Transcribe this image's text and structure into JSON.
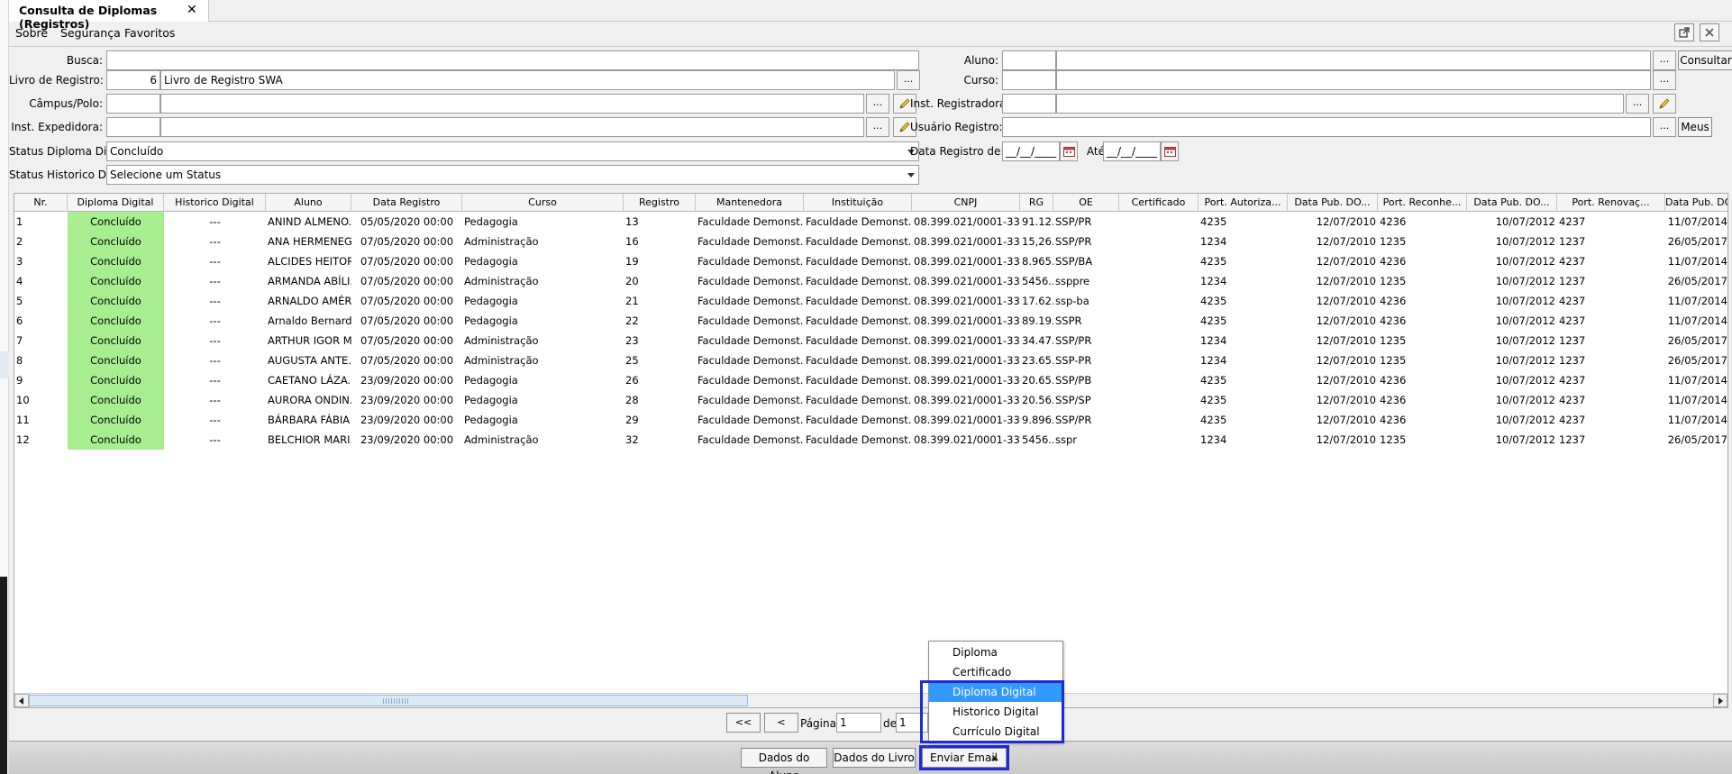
{
  "window": {
    "tab_title": "Consulta de Diplomas (Registros)",
    "tab_close": "✕"
  },
  "menu": {
    "sobre": "Sobre",
    "seguranca": "Segurança",
    "favoritos": "Favoritos"
  },
  "form": {
    "busca_label": "Busca:",
    "livro_label": "Livro de Registro:",
    "livro_code": "6",
    "livro_name": "Livro de Registro SWA",
    "campus_label": "Câmpus/Polo:",
    "inst_expedidora_label": "Inst. Expedidora:",
    "status_diploma_label": "Status Diploma Digital:",
    "status_diploma_value": "Concluído",
    "status_historico_label": "Status Historico Digital:",
    "status_historico_value": "Selecione um Status",
    "aluno_label": "Aluno:",
    "curso_label": "Curso:",
    "inst_registradora_label": "Inst. Registradora:",
    "usuario_registro_label": "Usuário Registro:",
    "data_registro_label": "Data Registro de:",
    "ate_label": "Até:",
    "date_mask": "__/__/____",
    "dots": "...",
    "consultar": "Consultar",
    "meus": "Meus"
  },
  "table": {
    "columns": [
      "Nr.",
      "Diploma Digital",
      "Historico Digital",
      "Aluno",
      "Data Registro",
      "Curso",
      "Registro",
      "Mantenedora",
      "Instituição",
      "CNPJ",
      "RG",
      "OE",
      "Certificado",
      "Port. Autoriza...",
      "Data Pub. DO...",
      "Port. Reconhe...",
      "Data Pub. DO...",
      "Port. Renovaç...",
      "Data Pub. DO..."
    ],
    "rows": [
      [
        "1",
        "Concluído",
        "---",
        "ANIND ALMENO...",
        "05/05/2020 00:00",
        "Pedagogia",
        "13",
        "Faculdade Demonst...",
        "Faculdade Demonst...",
        "08.399.021/0001-33",
        "91.12...",
        "SSP/PR",
        "",
        "4235",
        "12/07/2010",
        "4236",
        "10/07/2012",
        "4237",
        "11/07/2014"
      ],
      [
        "2",
        "Concluído",
        "---",
        "ANA HERMENEG...",
        "07/05/2020 00:00",
        "Administração",
        "16",
        "Faculdade Demonst...",
        "Faculdade Demonst...",
        "08.399.021/0001-33",
        "15,26...",
        "SSP/PR",
        "",
        "1234",
        "12/07/2010",
        "1235",
        "10/07/2012",
        "1237",
        "26/05/2017"
      ],
      [
        "3",
        "Concluído",
        "---",
        "ALCIDES HEITOR...",
        "07/05/2020 00:00",
        "Pedagogia",
        "19",
        "Faculdade Demonst...",
        "Faculdade Demonst...",
        "08.399.021/0001-33",
        "8.965...",
        "SSP/BA",
        "",
        "4235",
        "12/07/2010",
        "4236",
        "10/07/2012",
        "4237",
        "11/07/2014"
      ],
      [
        "4",
        "Concluído",
        "---",
        "ARMANDA ABÍLI...",
        "07/05/2020 00:00",
        "Administração",
        "20",
        "Faculdade Demonst...",
        "Faculdade Demonst...",
        "08.399.021/0001-33",
        "5456...",
        "ssppre",
        "",
        "1234",
        "12/07/2010",
        "1235",
        "10/07/2012",
        "1237",
        "26/05/2017"
      ],
      [
        "5",
        "Concluído",
        "---",
        "ARNALDO AMÉR...",
        "07/05/2020 00:00",
        "Pedagogia",
        "21",
        "Faculdade Demonst...",
        "Faculdade Demonst...",
        "08.399.021/0001-33",
        "17.62...",
        "ssp-ba",
        "",
        "4235",
        "12/07/2010",
        "4236",
        "10/07/2012",
        "4237",
        "11/07/2014"
      ],
      [
        "6",
        "Concluído",
        "---",
        "Arnaldo Bernardi...",
        "07/05/2020 00:00",
        "Pedagogia",
        "22",
        "Faculdade Demonst...",
        "Faculdade Demonst...",
        "08.399.021/0001-33",
        "89.19...",
        "SSPR",
        "",
        "4235",
        "12/07/2010",
        "4236",
        "10/07/2012",
        "4237",
        "11/07/2014"
      ],
      [
        "7",
        "Concluído",
        "---",
        "ARTHUR IGOR M...",
        "07/05/2020 00:00",
        "Administração",
        "23",
        "Faculdade Demonst...",
        "Faculdade Demonst...",
        "08.399.021/0001-33",
        "34.47...",
        "SSP/PR",
        "",
        "1234",
        "12/07/2010",
        "1235",
        "10/07/2012",
        "1237",
        "26/05/2017"
      ],
      [
        "8",
        "Concluído",
        "---",
        "AUGUSTA ANTE...",
        "07/05/2020 00:00",
        "Administração",
        "25",
        "Faculdade Demonst...",
        "Faculdade Demonst...",
        "08.399.021/0001-33",
        "23.65...",
        "SSP-PR",
        "",
        "1234",
        "12/07/2010",
        "1235",
        "10/07/2012",
        "1237",
        "26/05/2017"
      ],
      [
        "9",
        "Concluído",
        "---",
        "CAETANO LÁZA...",
        "23/09/2020 00:00",
        "Pedagogia",
        "26",
        "Faculdade Demonst...",
        "Faculdade Demonst...",
        "08.399.021/0001-33",
        "20.65...",
        "SSP/PB",
        "",
        "4235",
        "12/07/2010",
        "4236",
        "10/07/2012",
        "4237",
        "11/07/2014"
      ],
      [
        "10",
        "Concluído",
        "---",
        "AURORA ONDIN...",
        "23/09/2020 00:00",
        "Pedagogia",
        "28",
        "Faculdade Demonst...",
        "Faculdade Demonst...",
        "08.399.021/0001-33",
        "20.56...",
        "SSP/SP",
        "",
        "4235",
        "12/07/2010",
        "4236",
        "10/07/2012",
        "4237",
        "11/07/2014"
      ],
      [
        "11",
        "Concluído",
        "---",
        "BÁRBARA FÁBIA ...",
        "23/09/2020 00:00",
        "Pedagogia",
        "29",
        "Faculdade Demonst...",
        "Faculdade Demonst...",
        "08.399.021/0001-33",
        "9.896...",
        "SSP/PR",
        "",
        "4235",
        "12/07/2010",
        "4236",
        "10/07/2012",
        "4237",
        "11/07/2014"
      ],
      [
        "12",
        "Concluído",
        "---",
        "BELCHIOR MARI...",
        "23/09/2020 00:00",
        "Administração",
        "32",
        "Faculdade Demonst...",
        "Faculdade Demonst...",
        "08.399.021/0001-33",
        "5456...",
        "sspr",
        "",
        "1234",
        "12/07/2010",
        "1235",
        "10/07/2012",
        "1237",
        "26/05/2017"
      ]
    ]
  },
  "pager": {
    "first": "<<",
    "prev": "<",
    "page_label": "Página",
    "page_value": "1",
    "of_label": "de",
    "total_value": "1"
  },
  "bottom": {
    "dados_aluno": "Dados do Aluno",
    "dados_livro": "Dados do Livro",
    "enviar_email": "Enviar Email"
  },
  "dropdown": {
    "items": [
      "Diploma",
      "Certificado",
      "Diploma Digital",
      "Historico Digital",
      "Currículo Digital"
    ],
    "selected_index": 2
  },
  "colors": {
    "status_green": "#a8ee90",
    "selection_blue": "#3399ff",
    "focus_blue": "#1f2bd6"
  }
}
